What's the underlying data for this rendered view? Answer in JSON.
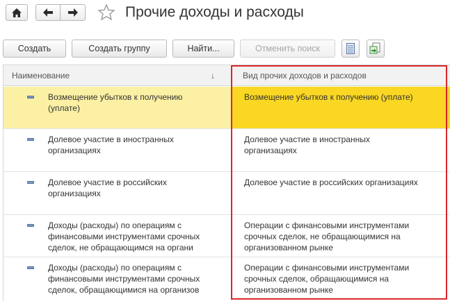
{
  "window": {
    "title": "Прочие доходы и расходы"
  },
  "toolbar": {
    "create_label": "Создать",
    "create_group_label": "Создать группу",
    "find_label": "Найти...",
    "cancel_search_label": "Отменить поиск",
    "list_settings_icon": "list-settings-icon",
    "export_icon": "export-icon"
  },
  "grid": {
    "headers": {
      "name": "Наименование",
      "sort_indicator": "↓",
      "type": "Вид прочих доходов и расходов"
    },
    "rows": [
      {
        "name": [
          "Возмещение убытков к получению",
          "(уплате)"
        ],
        "type": [
          "Возмещение убытков к получению (уплате)"
        ],
        "selected": true
      },
      {
        "name": [
          "Долевое участие в иностранных",
          "организациях"
        ],
        "type": [
          "Долевое участие в иностранных",
          "организациях"
        ],
        "selected": false
      },
      {
        "name": [
          "Долевое участие в российских",
          "организациях"
        ],
        "type": [
          "Долевое участие в российских организациях"
        ],
        "selected": false
      },
      {
        "name": [
          "Доходы (расходы) по операциям с",
          "финансовыми инструментами срочных",
          "сделок, не обращающимся на органи"
        ],
        "type": [
          "Операции с финансовыми инструментами",
          "срочных сделок, не обращающимися на",
          "организованном рынке"
        ],
        "selected": false
      },
      {
        "name": [
          "Доходы (расходы) по операциям с",
          "финансовыми инструментами срочных",
          "сделок, обращающимися на организов"
        ],
        "type": [
          "Операции с финансовыми инструментами",
          "срочных сделок, обращающимися на",
          "организованном рынке"
        ],
        "selected": false
      }
    ]
  },
  "colors": {
    "selected_name_bg": "#fbf0a4",
    "selected_type_bg": "#f9d723",
    "highlight_frame": "#d9262c"
  }
}
